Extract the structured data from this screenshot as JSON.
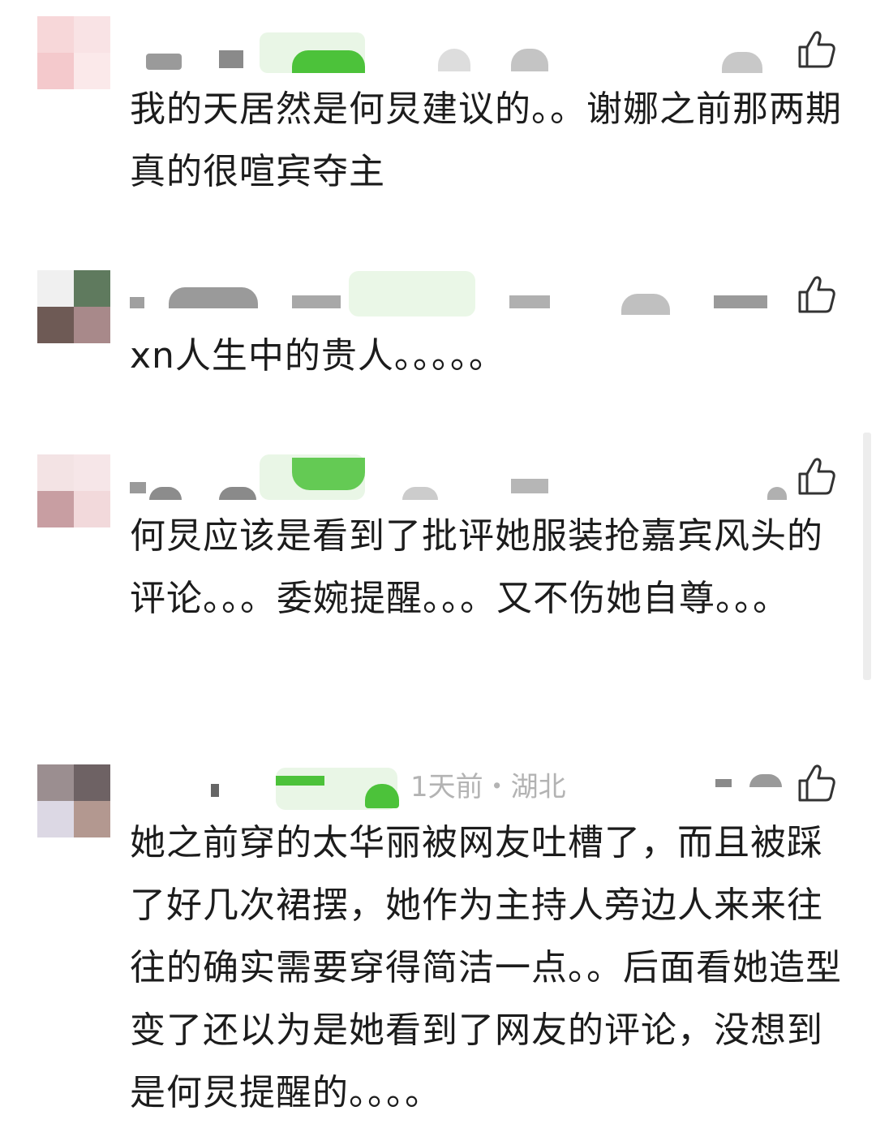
{
  "comments": [
    {
      "content": "我的天居然是何炅建议的。。谢娜之前那两期真的很喧宾夺主",
      "meta": "",
      "like_icon": "thumbs-up-icon",
      "name_redacted": true
    },
    {
      "content": "xn人生中的贵人。。。。。",
      "meta": "",
      "like_icon": "thumbs-up-icon",
      "name_redacted": true
    },
    {
      "content": "何炅应该是看到了批评她服装抢嘉宾风头的评论。。。委婉提醒。。。又不伤她自尊。。。",
      "meta": "",
      "like_icon": "thumbs-up-icon",
      "name_redacted": true
    },
    {
      "content": "她之前穿的太华丽被网友吐槽了，而且被踩了好几次裙摆，她作为主持人旁边人来来往往的确实需要穿得简洁一点。。后面看她造型变了还以为是她看到了网友的评论，没想到是何炅提醒的。。。。",
      "meta": "1天前・湖北",
      "like_icon": "thumbs-up-icon",
      "name_redacted": true
    }
  ],
  "colors": {
    "text": "#1c1c1c",
    "meta": "#b3b3b3",
    "redaction_green": "#4cc23a",
    "redaction_gray": "#8a8a8a"
  }
}
